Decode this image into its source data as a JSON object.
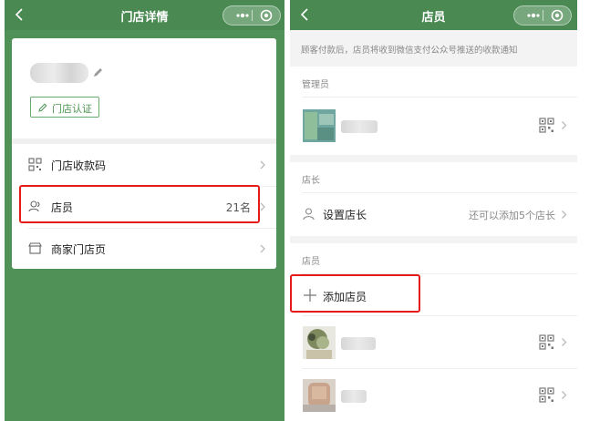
{
  "left": {
    "title": "门店详情",
    "certify_label": "门店认证",
    "rows": [
      {
        "label": "门店收款码",
        "value": ""
      },
      {
        "label": "店员",
        "value": "21名"
      },
      {
        "label": "商家门店页",
        "value": ""
      }
    ]
  },
  "right": {
    "title": "店员",
    "notice": "顾客付款后，店员将收到微信支付公众号推送的收款通知",
    "sections": {
      "admin": "管理员",
      "manager": "店长",
      "staff": "店员"
    },
    "set_manager_label": "设置店长",
    "set_manager_hint": "还可以添加5个店长",
    "add_staff_label": "添加店员"
  },
  "colors": {
    "nav_green": "#4a8a52",
    "page_green": "#4f9157",
    "highlight_red": "#e51a1a",
    "certify_green": "#4a9450"
  },
  "icons": [
    "back-icon",
    "more-icon",
    "close-target-icon",
    "edit-pencil-icon",
    "qr-code-icon",
    "staff-icon",
    "store-icon",
    "chevron-right-icon",
    "person-icon",
    "plus-icon"
  ]
}
